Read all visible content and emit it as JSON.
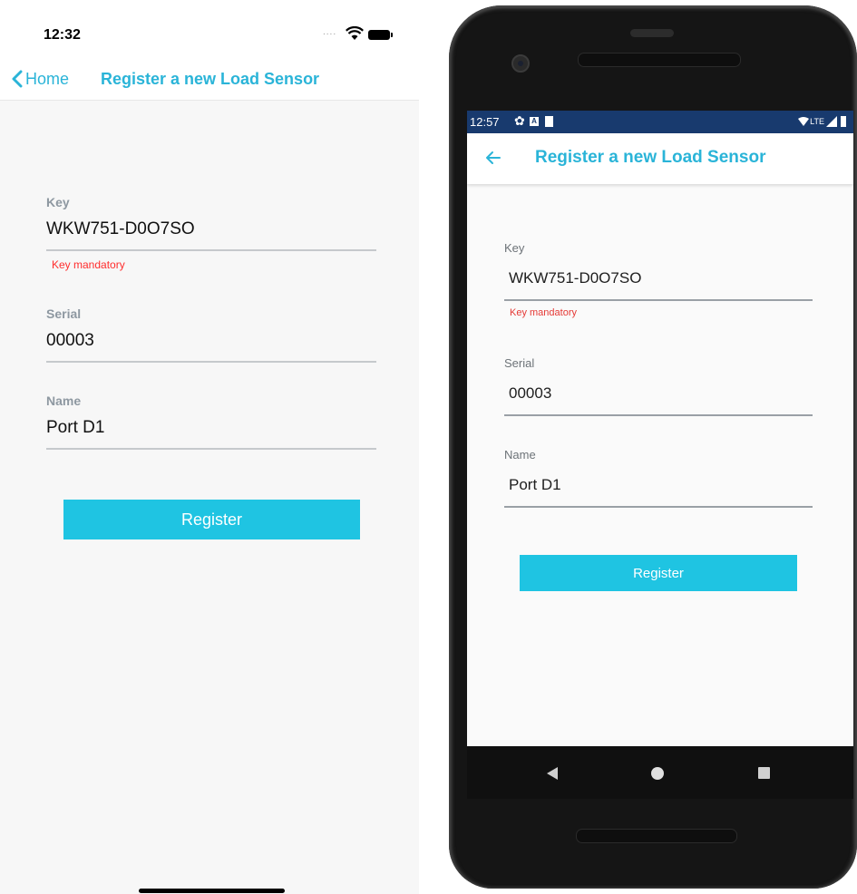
{
  "ios": {
    "status": {
      "time": "12:32",
      "signal_dots": "....",
      "wifi_icon": "wifi-icon",
      "battery_icon": "battery-icon"
    },
    "nav": {
      "back_label": "Home",
      "title": "Register a new Load Sensor"
    },
    "form": {
      "key": {
        "label": "Key",
        "value": "WKW751-D0O7SO",
        "error": "Key mandatory"
      },
      "serial": {
        "label": "Serial",
        "value": "00003"
      },
      "name": {
        "label": "Name",
        "value": "Port D1"
      },
      "register_label": "Register"
    }
  },
  "android": {
    "status": {
      "time": "12:57",
      "a_badge": "A",
      "network": "LTE"
    },
    "appbar": {
      "title": "Register a new Load Sensor",
      "back_icon": "arrow-left-icon"
    },
    "form": {
      "key": {
        "label": "Key",
        "value": "WKW751-D0O7SO",
        "error": "Key mandatory"
      },
      "serial": {
        "label": "Serial",
        "value": "00003"
      },
      "name": {
        "label": "Name",
        "value": "Port D1"
      },
      "register_label": "Register"
    },
    "navbar": [
      "nav-back-icon",
      "nav-home-icon",
      "nav-recents-icon"
    ]
  },
  "colors": {
    "accent": "#2ab4d8",
    "button": "#1fc4e2",
    "error": "#ff2d2d",
    "android_status": "#183a6e"
  }
}
